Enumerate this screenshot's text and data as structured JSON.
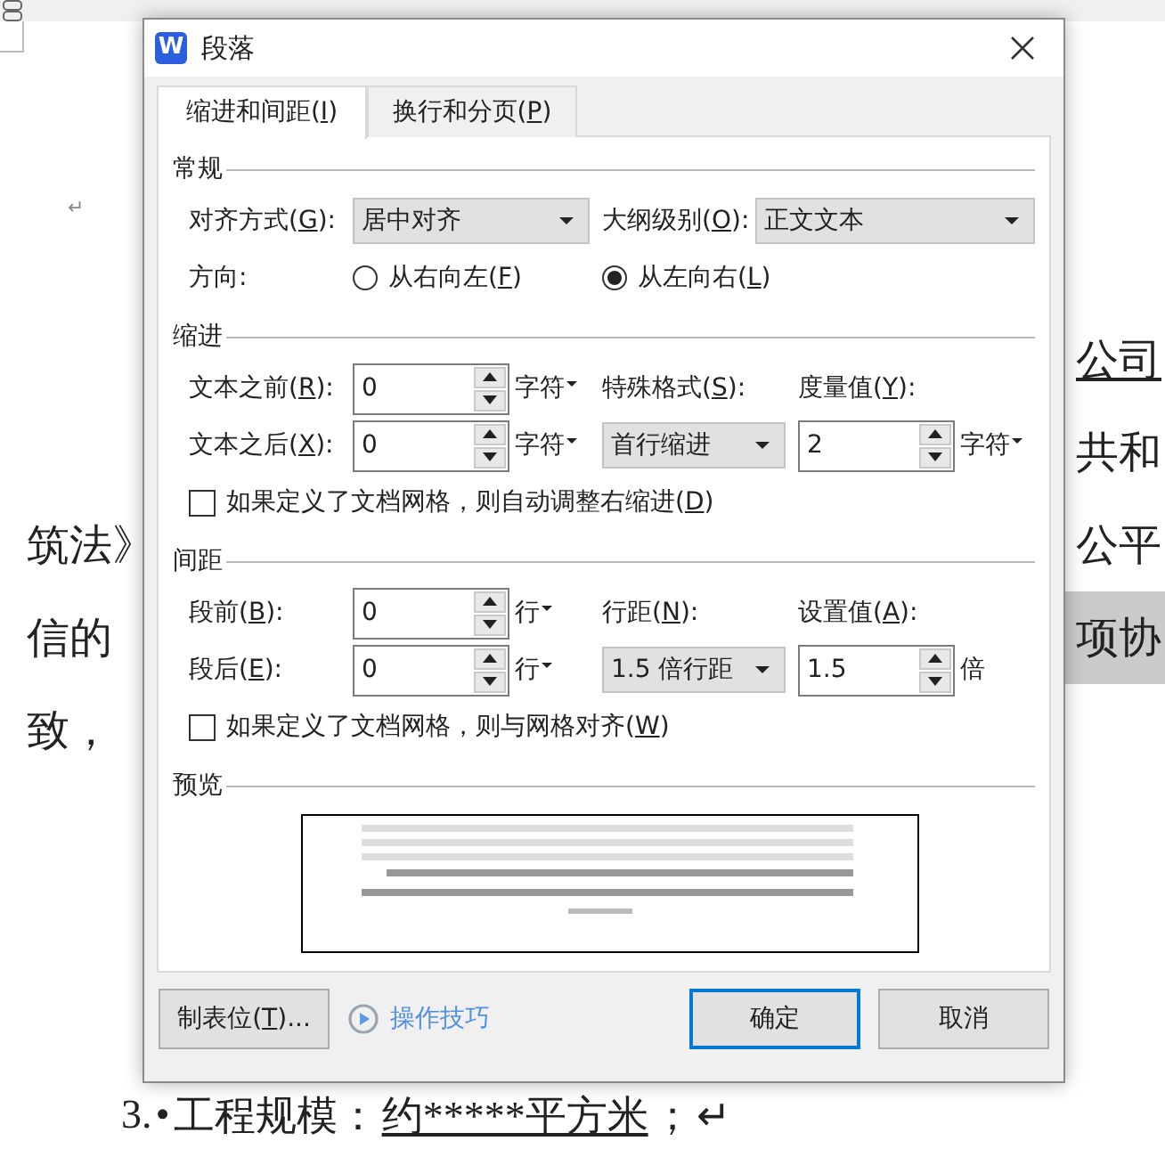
{
  "document": {
    "return_mark": "↵",
    "lines": [
      {
        "right": {
          "text": "公司",
          "underlined": true,
          "highlighted": false
        }
      },
      {
        "right": {
          "text": "共和",
          "underlined": false,
          "highlighted": false
        }
      },
      {
        "left": {
          "text": "筑法》"
        },
        "right": {
          "text": "公平",
          "underlined": false,
          "highlighted": false
        }
      },
      {
        "left": {
          "text": "信的"
        },
        "right": {
          "text": "项协",
          "underlined": false,
          "highlighted": true
        }
      },
      {
        "left": {
          "text": "致，"
        }
      }
    ],
    "last_line": [
      {
        "text": "3.",
        "underlined": false
      },
      {
        "text": "•",
        "underlined": false
      },
      {
        "text": "工程规模：",
        "underlined": false
      },
      {
        "text": "约*****平方米",
        "underlined": true
      },
      {
        "text": "；",
        "underlined": false
      },
      {
        "text": "↵",
        "underlined": false
      }
    ]
  },
  "dialog": {
    "icon_letter": "W",
    "title": "段落",
    "tabs": [
      {
        "label": "缩进和间距(I)",
        "selected": true
      },
      {
        "label": "换行和分页(P)",
        "selected": false
      }
    ],
    "general": {
      "title": "常规",
      "alignment": {
        "label": "对齐方式(G):",
        "value": "居中对齐"
      },
      "outline_level": {
        "label": "大纲级别(O):",
        "value": "正文文本"
      },
      "direction": {
        "label": "方向:",
        "options": [
          {
            "label": "从右向左(F)",
            "selected": false
          },
          {
            "label": "从左向右(L)",
            "selected": true
          }
        ]
      }
    },
    "indent": {
      "title": "缩进",
      "before": {
        "label": "文本之前(R):",
        "value": "0",
        "unit": {
          "text": "字符",
          "menu": true
        }
      },
      "after": {
        "label": "文本之后(X):",
        "value": "0",
        "unit": {
          "text": "字符",
          "menu": true
        }
      },
      "special": {
        "label": "特殊格式(S):",
        "value": "首行缩进"
      },
      "by": {
        "label": "度量值(Y):",
        "value": "2",
        "unit": {
          "text": "字符",
          "menu": true
        }
      },
      "auto_adjust": {
        "label": "如果定义了文档网格，则自动调整右缩进(D)",
        "checked": false
      }
    },
    "spacing": {
      "title": "间距",
      "before": {
        "label": "段前(B):",
        "value": "0",
        "unit": {
          "text": "行",
          "menu": true
        }
      },
      "after": {
        "label": "段后(E):",
        "value": "0",
        "unit": {
          "text": "行",
          "menu": true
        }
      },
      "line_spacing": {
        "label": "行距(N):",
        "value": "1.5 倍行距"
      },
      "at": {
        "label": "设置值(A):",
        "value": "1.5",
        "unit": {
          "text": "倍",
          "menu": false
        }
      },
      "snap_to_grid": {
        "label": "如果定义了文档网格，则与网格对齐(W)",
        "checked": false
      }
    },
    "preview": {
      "title": "预览"
    },
    "buttons": {
      "tab_stops": "制表位(T)...",
      "tips": "操作技巧",
      "ok": "确定",
      "cancel": "取消"
    }
  }
}
